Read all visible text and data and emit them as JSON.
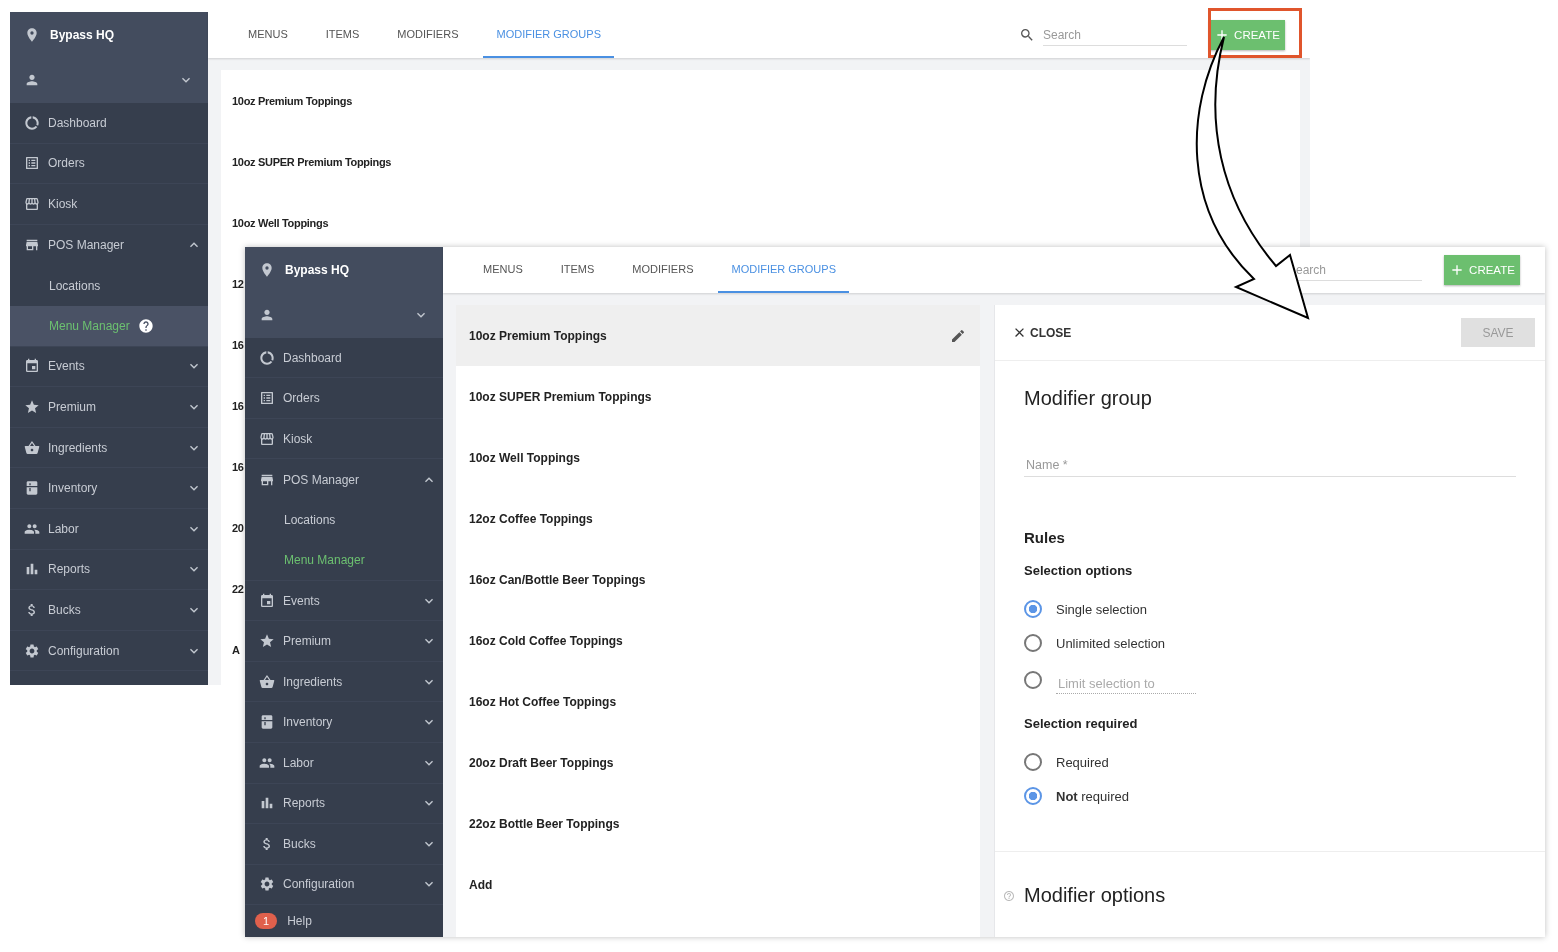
{
  "back_screen": {
    "sidebar": {
      "location": "Bypass HQ",
      "items": [
        {
          "kind": "nav",
          "label": "Dashboard",
          "selected": false
        },
        {
          "kind": "nav",
          "label": "Orders",
          "selected": false
        },
        {
          "kind": "nav",
          "label": "Kiosk",
          "selected": false
        },
        {
          "kind": "nav",
          "label": "POS Manager",
          "selected": false,
          "expanded": true,
          "children": [
            {
              "label": "Locations",
              "selected": false,
              "highlighted": false,
              "help_icon": false
            },
            {
              "label": "Menu Manager",
              "selected": true,
              "highlighted": true,
              "help_icon": true
            }
          ]
        },
        {
          "kind": "nav",
          "label": "Events",
          "selected": false,
          "expanded": false
        },
        {
          "kind": "nav",
          "label": "Premium",
          "selected": false,
          "expanded": false
        },
        {
          "kind": "nav",
          "label": "Ingredients",
          "selected": false,
          "expanded": false
        },
        {
          "kind": "nav",
          "label": "Inventory",
          "selected": false,
          "expanded": false
        },
        {
          "kind": "nav",
          "label": "Labor",
          "selected": false,
          "expanded": false
        },
        {
          "kind": "nav",
          "label": "Reports",
          "selected": false,
          "expanded": false
        },
        {
          "kind": "nav",
          "label": "Bucks",
          "selected": false,
          "expanded": false
        },
        {
          "kind": "nav",
          "label": "Configuration",
          "selected": false,
          "expanded": false
        }
      ]
    },
    "tabs": [
      {
        "label": "MENUS",
        "selected": false
      },
      {
        "label": "ITEMS",
        "selected": false
      },
      {
        "label": "MODIFIERS",
        "selected": false
      },
      {
        "label": "MODIFIER GROUPS",
        "selected": true
      }
    ],
    "search": {
      "placeholder": "Search",
      "icon": true
    },
    "create_button": {
      "label": "CREATE",
      "highlighted": true
    },
    "list": [
      {
        "label": "10oz Premium Toppings",
        "selected": false
      },
      {
        "label": "10oz SUPER Premium Toppings",
        "selected": false
      },
      {
        "label": "10oz Well Toppings",
        "selected": false
      },
      {
        "label": "12",
        "selected": false
      },
      {
        "label": "16",
        "selected": false
      },
      {
        "label": "16",
        "selected": false
      },
      {
        "label": "16",
        "selected": false
      },
      {
        "label": "20",
        "selected": false
      },
      {
        "label": "22",
        "selected": false
      },
      {
        "label": "A",
        "selected": false
      }
    ]
  },
  "front_screen": {
    "sidebar": {
      "location": "Bypass HQ",
      "items": [
        {
          "kind": "nav",
          "label": "Dashboard",
          "selected": false
        },
        {
          "kind": "nav",
          "label": "Orders",
          "selected": false
        },
        {
          "kind": "nav",
          "label": "Kiosk",
          "selected": false
        },
        {
          "kind": "nav",
          "label": "POS Manager",
          "selected": false,
          "expanded": true,
          "children": [
            {
              "label": "Locations",
              "selected": false,
              "highlighted": false,
              "help_icon": false
            },
            {
              "label": "Menu Manager",
              "selected": true,
              "highlighted": false,
              "help_icon": false
            }
          ]
        },
        {
          "kind": "nav",
          "label": "Events",
          "selected": false,
          "expanded": false
        },
        {
          "kind": "nav",
          "label": "Premium",
          "selected": false,
          "expanded": false
        },
        {
          "kind": "nav",
          "label": "Ingredients",
          "selected": false,
          "expanded": false
        },
        {
          "kind": "nav",
          "label": "Inventory",
          "selected": false,
          "expanded": false
        },
        {
          "kind": "nav",
          "label": "Labor",
          "selected": false,
          "expanded": false
        },
        {
          "kind": "nav",
          "label": "Reports",
          "selected": false,
          "expanded": false
        },
        {
          "kind": "nav",
          "label": "Bucks",
          "selected": false,
          "expanded": false
        },
        {
          "kind": "nav",
          "label": "Configuration",
          "selected": false,
          "expanded": false
        },
        {
          "kind": "help",
          "label": "Help",
          "badge": "1",
          "selected": false
        }
      ]
    },
    "tabs": [
      {
        "label": "MENUS",
        "selected": false
      },
      {
        "label": "ITEMS",
        "selected": false
      },
      {
        "label": "MODIFIERS",
        "selected": false
      },
      {
        "label": "MODIFIER GROUPS",
        "selected": true
      }
    ],
    "search": {
      "placeholder": "earch",
      "icon": false
    },
    "create_button": {
      "label": "CREATE"
    },
    "list": [
      {
        "label": "10oz Premium Toppings",
        "selected": true
      },
      {
        "label": "10oz SUPER Premium Toppings",
        "selected": false
      },
      {
        "label": "10oz Well Toppings",
        "selected": false
      },
      {
        "label": "12oz Coffee Toppings",
        "selected": false
      },
      {
        "label": "16oz Can/Bottle Beer Toppings",
        "selected": false
      },
      {
        "label": "16oz Cold Coffee Toppings",
        "selected": false
      },
      {
        "label": "16oz Hot Coffee Toppings",
        "selected": false
      },
      {
        "label": "20oz Draft Beer Toppings",
        "selected": false
      },
      {
        "label": "22oz Bottle Beer Toppings",
        "selected": false
      },
      {
        "label": "Add",
        "selected": false
      }
    ],
    "editor": {
      "close": "CLOSE",
      "save": "SAVE",
      "save_disabled": true,
      "title": "Modifier group",
      "name_field": {
        "placeholder": "Name *"
      },
      "rules_title": "Rules",
      "selection_options": {
        "title": "Selection options",
        "options": [
          {
            "kind": "radio",
            "label": "Single selection",
            "selected": true
          },
          {
            "kind": "radio",
            "label": "Unlimited selection",
            "selected": false
          },
          {
            "kind": "limit_field",
            "placeholder": "Limit selection to",
            "selected": false
          }
        ]
      },
      "selection_required": {
        "title": "Selection required",
        "options": [
          {
            "kind": "radio",
            "label": "Required",
            "selected": false
          },
          {
            "kind": "radio",
            "label": "**Not** required",
            "selected": true
          }
        ]
      },
      "options_title": "Modifier options"
    }
  }
}
